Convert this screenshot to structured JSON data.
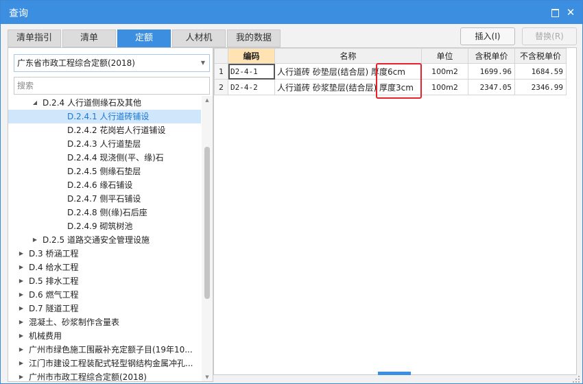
{
  "window": {
    "title": "查询"
  },
  "tabs": [
    {
      "label": "清单指引"
    },
    {
      "label": "清单"
    },
    {
      "label": "定额"
    },
    {
      "label": "人材机"
    },
    {
      "label": "我的数据"
    }
  ],
  "actions": {
    "insert": "插入(I)",
    "replace": "替换(R)"
  },
  "left": {
    "quota_library": "广东省市政工程综合定额(2018)",
    "search_placeholder": "搜索",
    "tree": [
      {
        "label": "D.2.4 人行道侧缘石及其他",
        "expand": "expanded"
      },
      {
        "label": "D.2.4.1 人行道砖铺设",
        "expand": "none"
      },
      {
        "label": "D.2.4.2 花岗岩人行道铺设",
        "expand": "none"
      },
      {
        "label": "D.2.4.3 人行道垫层",
        "expand": "none"
      },
      {
        "label": "D.2.4.4 现浇侧(平、缘)石",
        "expand": "none"
      },
      {
        "label": "D.2.4.5 侧缘石垫层",
        "expand": "none"
      },
      {
        "label": "D.2.4.6 缘石铺设",
        "expand": "none"
      },
      {
        "label": "D.2.4.7 侧平石铺设",
        "expand": "none"
      },
      {
        "label": "D.2.4.8 侧(缘)石后座",
        "expand": "none"
      },
      {
        "label": "D.2.4.9 砌筑树池",
        "expand": "none"
      },
      {
        "label": "D.2.5 道路交通安全管理设施",
        "expand": "collapsed"
      },
      {
        "label": "D.3 桥涵工程",
        "expand": "collapsed"
      },
      {
        "label": "D.4 给水工程",
        "expand": "collapsed"
      },
      {
        "label": "D.5 排水工程",
        "expand": "collapsed"
      },
      {
        "label": "D.6 燃气工程",
        "expand": "collapsed"
      },
      {
        "label": "D.7 隧道工程",
        "expand": "collapsed"
      },
      {
        "label": "混凝土、砂浆制作含量表",
        "expand": "collapsed"
      },
      {
        "label": "机械费用",
        "expand": "collapsed"
      },
      {
        "label": "广州市绿色施工围蔽补充定额子目(19年10...",
        "expand": "collapsed"
      },
      {
        "label": "江门市建设工程装配式轻型钢结构金属冲孔...",
        "expand": "collapsed"
      },
      {
        "label": "广州市市政工程综合定额(2018)",
        "expand": "collapsed"
      }
    ]
  },
  "grid": {
    "headers": {
      "code": "编码",
      "name": "名称",
      "unit": "单位",
      "price_tax": "含税单价",
      "price_notax": "不含税单价"
    },
    "rows": [
      {
        "no": "1",
        "code": "D2-4-1",
        "name": "人行道砖 砂垫层(结合层) 厚度6cm",
        "unit": "100m2",
        "price_tax": "1699.96",
        "price_notax": "1684.59"
      },
      {
        "no": "2",
        "code": "D2-4-2",
        "name": "人行道砖 砂浆垫层(结合层) 厚度3cm",
        "unit": "100m2",
        "price_tax": "2347.05",
        "price_notax": "2346.99"
      }
    ]
  },
  "colors": {
    "accent": "#3b8ee0",
    "highlight_box": "#e8202a",
    "selected_row": "#cfe6fb"
  }
}
